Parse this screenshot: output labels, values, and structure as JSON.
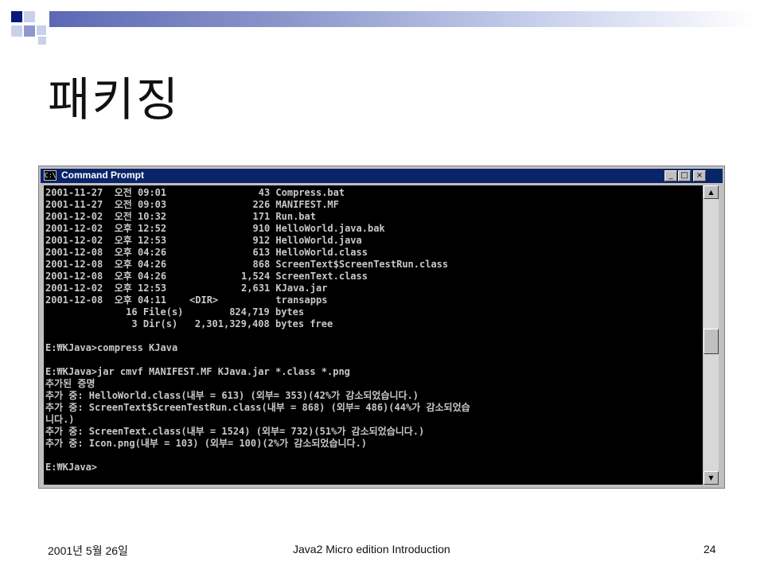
{
  "slide": {
    "title": "패키징",
    "footer_date": "2001년 5월 26일",
    "footer_center": "Java2 Micro edition Introduction",
    "page_number": "24"
  },
  "window": {
    "title": "Command Prompt",
    "icon_text": "C:\\",
    "minimize_glyph": "_",
    "maximize_glyph": "□",
    "close_glyph": "×",
    "scroll_up_glyph": "▲",
    "scroll_down_glyph": "▼"
  },
  "console": {
    "lines": [
      "2001-11-27  오전 09:01                43 Compress.bat",
      "2001-11-27  오전 09:03               226 MANIFEST.MF",
      "2001-12-02  오전 10:32               171 Run.bat",
      "2001-12-02  오후 12:52               910 HelloWorld.java.bak",
      "2001-12-02  오후 12:53               912 HelloWorld.java",
      "2001-12-08  오후 04:26               613 HelloWorld.class",
      "2001-12-08  오후 04:26               868 ScreenText$ScreenTestRun.class",
      "2001-12-08  오후 04:26             1,524 ScreenText.class",
      "2001-12-02  오후 12:53             2,631 KJava.jar",
      "2001-12-08  오후 04:11    <DIR>          transapps",
      "              16 File(s)        824,719 bytes",
      "               3 Dir(s)   2,301,329,408 bytes free",
      "",
      "E:₩KJava>compress KJava",
      "",
      "E:₩KJava>jar cmvf MANIFEST.MF KJava.jar *.class *.png",
      "추가된 증명",
      "추가 중: HelloWorld.class(내부 = 613) (외부= 353)(42%가 감소되었습니다.)",
      "추가 중: ScreenText$ScreenTestRun.class(내부 = 868) (외부= 486)(44%가 감소되었습",
      "니다.)",
      "추가 중: ScreenText.class(내부 = 1524) (외부= 732)(51%가 감소되었습니다.)",
      "추가 중: Icon.png(내부 = 103) (외부= 100)(2%가 감소되었습니다.)",
      "",
      "E:₩KJava>"
    ]
  }
}
